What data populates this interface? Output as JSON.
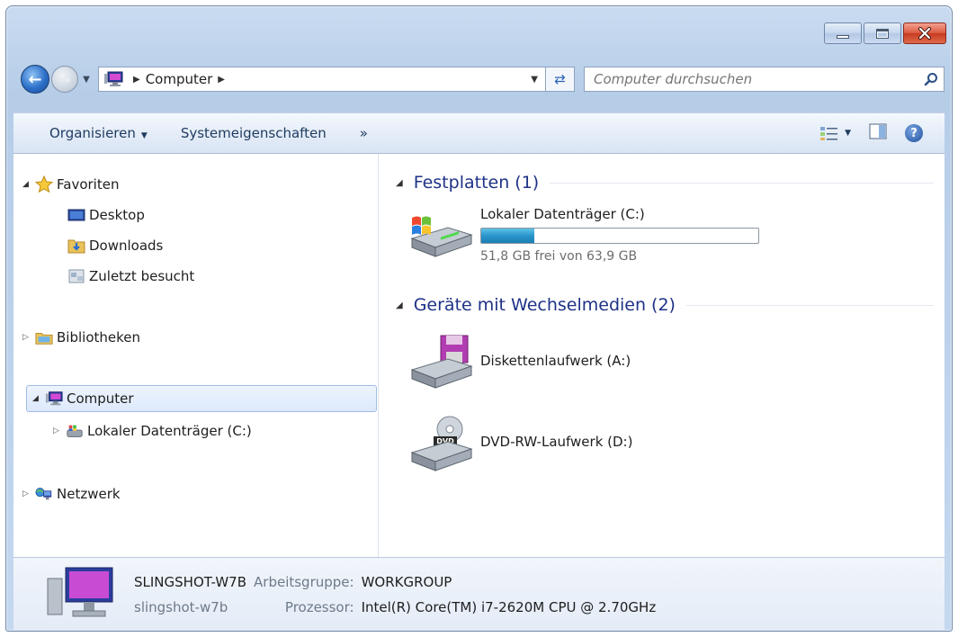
{
  "window": {
    "buttons": {
      "minimize": "minimize",
      "maximize": "maximize",
      "close": "close"
    }
  },
  "address_bar": {
    "crumbs": [
      "Computer"
    ],
    "search_placeholder": "Computer durchsuchen"
  },
  "command_bar": {
    "organize": "Organisieren",
    "system_properties": "Systemeigenschaften",
    "more": "»"
  },
  "nav_pane": {
    "favorites": {
      "label": "Favoriten",
      "items": [
        "Desktop",
        "Downloads",
        "Zuletzt besucht"
      ]
    },
    "libraries": {
      "label": "Bibliotheken"
    },
    "computer": {
      "label": "Computer",
      "children": [
        "Lokaler Datenträger (C:)"
      ]
    },
    "network": {
      "label": "Netzwerk"
    }
  },
  "main_pane": {
    "groups": [
      {
        "title": "Festplatten (1)"
      },
      {
        "title": "Geräte mit Wechselmedien (2)"
      }
    ],
    "hard_disks": [
      {
        "name": "Lokaler Datenträger (C:)",
        "free_text": "51,8 GB frei von 63,9 GB",
        "used_fraction": 0.19
      }
    ],
    "removable": [
      {
        "name": "Diskettenlaufwerk (A:)"
      },
      {
        "name": "DVD-RW-Laufwerk (D:)"
      }
    ]
  },
  "details": {
    "computer_name": "SLINGSHOT-W7B",
    "computer_sub": "slingshot-w7b",
    "workgroup_label": "Arbeitsgruppe:",
    "workgroup_value": "WORKGROUP",
    "processor_label": "Prozessor:",
    "processor_value": "Intel(R) Core(TM) i7-2620M CPU @ 2.70GHz"
  },
  "colors": {
    "group_header": "#1e3287",
    "usage_bar": "#2a95cb",
    "selection": "#dce9fb"
  }
}
